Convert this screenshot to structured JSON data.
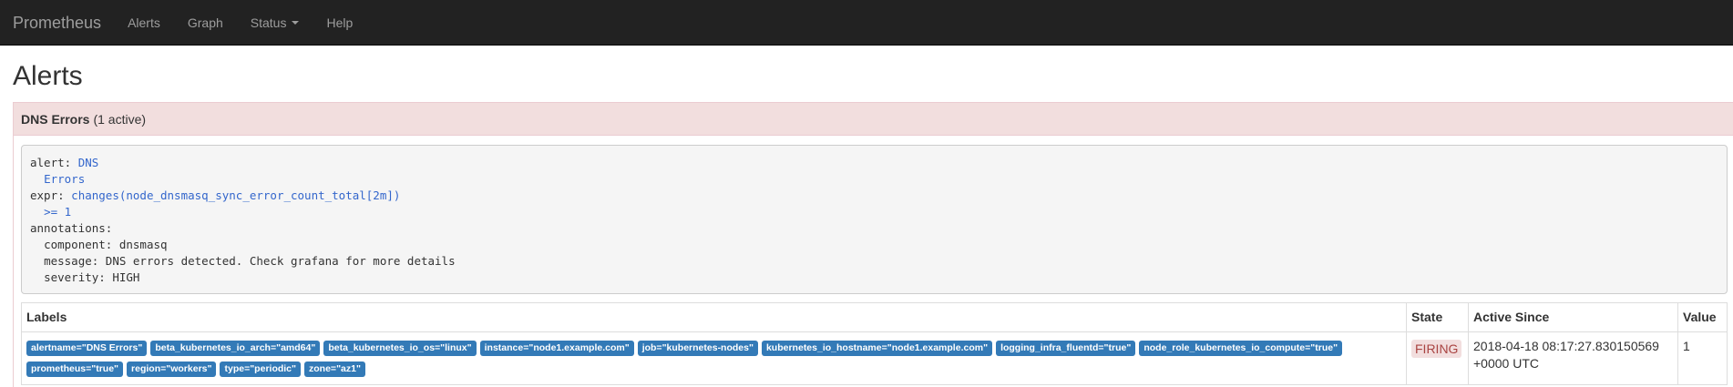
{
  "navbar": {
    "brand": "Prometheus",
    "items": [
      {
        "label": "Alerts"
      },
      {
        "label": "Graph"
      },
      {
        "label": "Status"
      },
      {
        "label": "Help"
      }
    ]
  },
  "page": {
    "title": "Alerts"
  },
  "alert_group": {
    "name": "DNS Errors",
    "count": "(1 active)",
    "rule": {
      "alert_key": "alert:",
      "alert_value_1": "DNS",
      "alert_value_2": "Errors",
      "expr_key": "expr:",
      "expr_value_1": "changes(node_dnsmasq_sync_error_count_total[2m])",
      "expr_value_2": ">= 1",
      "annotations_key": "annotations:",
      "component_line": "component: dnsmasq",
      "message_line": "message: DNS errors detected. Check grafana for more details",
      "severity_line": "severity: HIGH"
    },
    "table": {
      "headers": {
        "labels": "Labels",
        "state": "State",
        "active_since": "Active Since",
        "value": "Value"
      },
      "rows": [
        {
          "labels": [
            "alertname=\"DNS Errors\"",
            "beta_kubernetes_io_arch=\"amd64\"",
            "beta_kubernetes_io_os=\"linux\"",
            "instance=\"node1.example.com\"",
            "job=\"kubernetes-nodes\"",
            "kubernetes_io_hostname=\"node1.example.com\"",
            "logging_infra_fluentd=\"true\"",
            "node_role_kubernetes_io_compute=\"true\"",
            "prometheus=\"true\"",
            "region=\"workers\"",
            "type=\"periodic\"",
            "zone=\"az1\""
          ],
          "state": "FIRING",
          "active_since_1": "2018-04-18 08:17:27.830150569",
          "active_since_2": "+0000 UTC",
          "value": "1"
        }
      ]
    }
  },
  "colors": {
    "navbar_bg": "#222222",
    "danger_bg": "#f2dede",
    "label_blue": "#337ab7",
    "firing_text": "#a94442"
  }
}
